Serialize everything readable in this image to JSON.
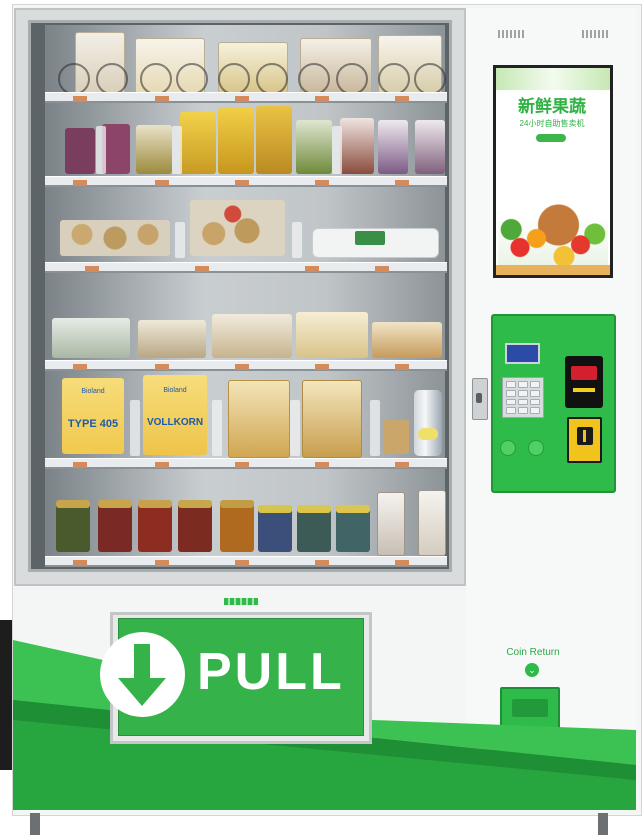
{
  "machine": {
    "type": "vending machine",
    "accent_color": "#2fbb49",
    "body_color": "#f4f5f5"
  },
  "advertisement": {
    "title": "新鲜果蔬",
    "subtitle": "24小时自助售卖机",
    "image": "fruit-and-vegetable-basket"
  },
  "products": {
    "shelf_1": [
      "snack bags"
    ],
    "shelf_2": [
      "dried fruit packs"
    ],
    "shelf_3": [
      "bread rolls",
      "egg carton"
    ],
    "shelf_4": [
      "sandwich packs",
      "cheese"
    ],
    "shelf_5": {
      "flour_1_brand": "Bioland",
      "flour_1_label": "TYPE 405",
      "flour_2_brand": "Bioland",
      "flour_2_label": "VOLLKORN",
      "other": [
        "pasta",
        "pasta",
        "canned drink"
      ]
    },
    "shelf_6": [
      "pesto jars",
      "sauce jars",
      "honey jars",
      "pasta boxes"
    ]
  },
  "payment": {
    "card_reader": "card-reader-screen",
    "keypad_icon": "keypad-icon",
    "bill_acceptor_icon": "bill-acceptor-icon",
    "coin_acceptor_icon": "coin-acceptor-icon"
  },
  "coin_return": {
    "label": "Coin Return",
    "icon": "chevron-down-icon"
  },
  "pickup": {
    "label": "PULL",
    "icon": "arrow-down-icon"
  }
}
